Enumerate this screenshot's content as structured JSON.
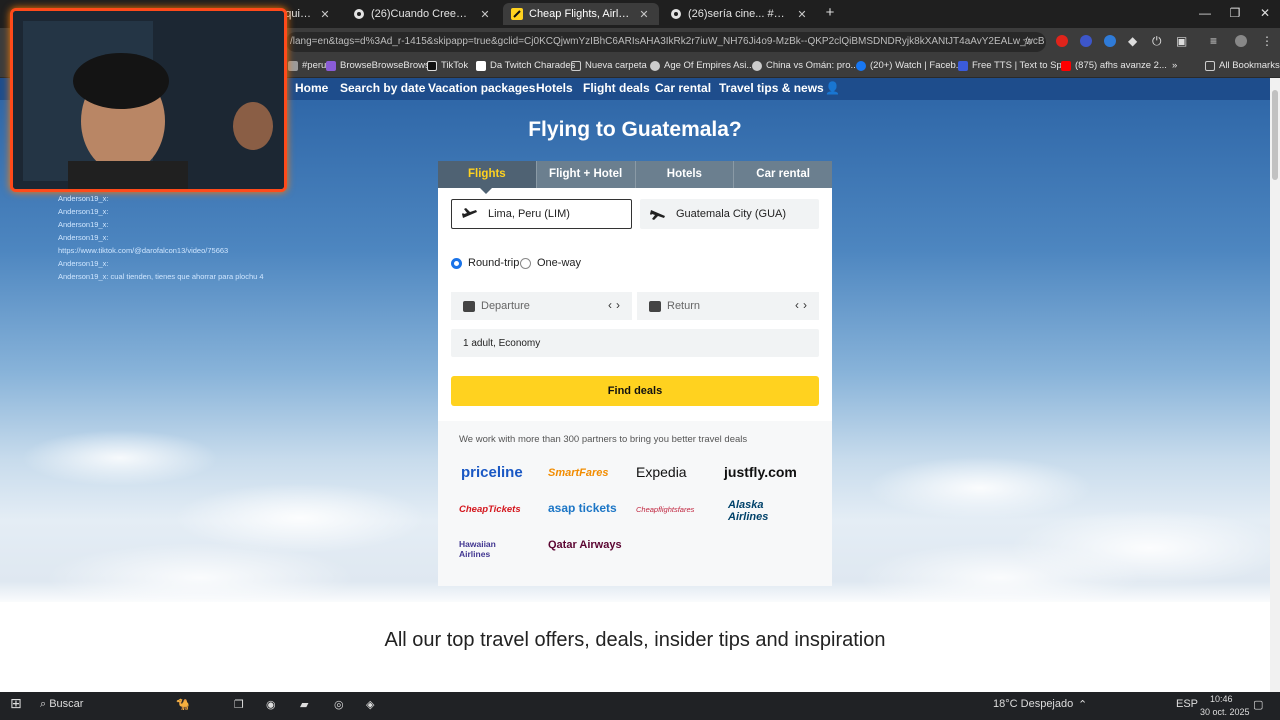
{
  "browser": {
    "tabs": [
      {
        "title": "Maquina",
        "active": false
      },
      {
        "title": "(26)Cuando Crees Ser Chef y C",
        "active": false
      },
      {
        "title": "Cheap Flights, Airline Tickets &",
        "active": true
      },
      {
        "title": "(26)sería cine... #avengers #ave",
        "active": false
      }
    ],
    "url": "/lang=en&tags=d%3Ad_r-1415&skipapp=true&gclid=Cj0KCQjwmYzIBhC6ARIsAHA3IkRk2r7iuW_NH76Ji4o9-MzBk--QKP2clQiBMSDNDRyjk8kXANtJT4aAvY2EALw_wcB",
    "bookmarks": [
      {
        "label": "#peru...",
        "color": "#9b9b9b"
      },
      {
        "label": "BrowseBrowseBrowse",
        "color": "#8a5cd6"
      },
      {
        "label": "TikTok",
        "color": "#111111"
      },
      {
        "label": "Da Twitch Charades",
        "color": "#ffffff"
      },
      {
        "label": "Nueva carpeta",
        "color": "#cccccc"
      },
      {
        "label": "Age Of Empires Asi...",
        "color": "#cccccc"
      },
      {
        "label": "China vs Omán: pro...",
        "color": "#cccccc"
      },
      {
        "label": "(20+) Watch | Faceb...",
        "color": "#1877f2"
      },
      {
        "label": "Free TTS | Text to Sp...",
        "color": "#3b5bdb"
      },
      {
        "label": "(875) afhs avanze 2...",
        "color": "#ff0000"
      },
      {
        "label": "All Bookmarks",
        "color": "#cccccc"
      }
    ]
  },
  "site": {
    "nav": [
      "Home",
      "Search by date",
      "Vacation packages",
      "Hotels",
      "Flight deals",
      "Car rental",
      "Travel tips & news"
    ],
    "headline": "Flying to Guatemala?",
    "search_tabs": [
      "Flights",
      "Flight + Hotel",
      "Hotels",
      "Car rental"
    ],
    "active_tab": "Flights",
    "origin": "Lima, Peru (LIM)",
    "destination": "Guatemala City (GUA)",
    "trip_type": {
      "round_trip": "Round-trip",
      "one_way": "One-way",
      "selected": "Round-trip"
    },
    "departure_placeholder": "Departure",
    "return_placeholder": "Return",
    "passengers": "1 adult, Economy",
    "find_button": "Find deals",
    "partners_text": "We work with more than 300 partners to bring you better travel deals",
    "partners": [
      "priceline",
      "SmartFares",
      "Expedia",
      "justfly.com",
      "CheapTickets",
      "asap tickets",
      "Cheapflightsfares",
      "Alaska Airlines",
      "Hawaiian Airlines",
      "Qatar Airways"
    ],
    "tagline": "All our top travel offers, deals, insider tips and inspiration"
  },
  "stream_chat": [
    "Anderson19_x:",
    "Anderson19_x:",
    "Anderson19_x:",
    "Anderson19_x:",
    "https://www.tiktok.com/@darofalcon13/video/75663",
    "Anderson19_x:",
    "Anderson19_x: cual tienden, tienes que ahorrar para plochu 4"
  ],
  "taskbar": {
    "search": "Buscar",
    "weather": "18°C  Despejado",
    "lang": "ESP",
    "time": "10:46",
    "date": "30 oct. 2025"
  }
}
